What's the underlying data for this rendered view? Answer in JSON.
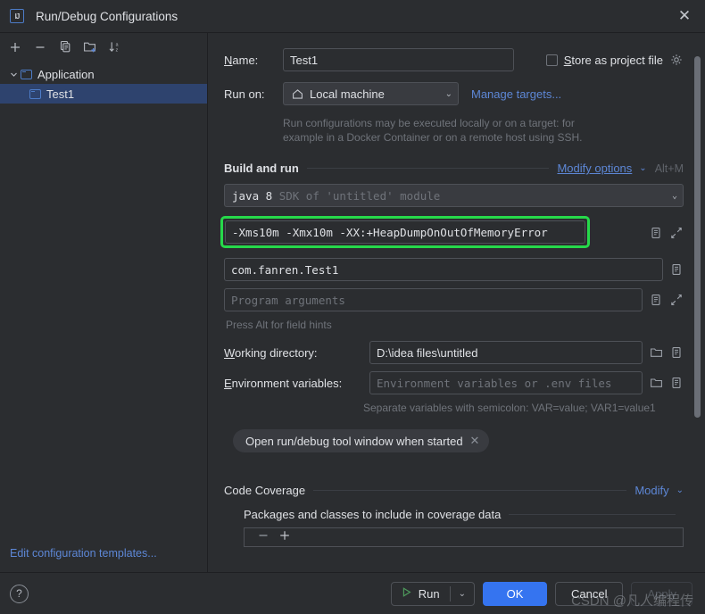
{
  "window": {
    "title": "Run/Debug Configurations",
    "logo_text": "IJ",
    "close_icon": "✕"
  },
  "sidebar": {
    "toolbar": [
      {
        "name": "add-configuration-button",
        "icon": "plus-icon",
        "glyph": "+"
      },
      {
        "name": "remove-configuration-button",
        "icon": "minus-icon",
        "glyph": "−"
      },
      {
        "name": "copy-configuration-button",
        "icon": "copy-icon",
        "glyph": ""
      },
      {
        "name": "new-folder-button",
        "icon": "new-folder-icon",
        "glyph": ""
      },
      {
        "name": "sort-configurations-button",
        "icon": "sort-az-icon",
        "glyph": ""
      }
    ],
    "tree": [
      {
        "label": "Application",
        "expanded": true,
        "selected": false,
        "chevron": "⌄"
      },
      {
        "label": "Test1",
        "expanded": false,
        "selected": true,
        "chevron": ""
      }
    ],
    "edit_templates_link": "Edit configuration templates..."
  },
  "form": {
    "name_label": "Name:",
    "name_label_mnemonic": "N",
    "name_value": "Test1",
    "store_as_project_file_label": "Store as project file",
    "store_as_project_file_mnemonic": "S",
    "store_as_project_file_checked": false,
    "store_gear_icon": "gear-icon",
    "run_on_label": "Run on:",
    "run_on_value": "Local machine",
    "run_on_icon": "home-icon",
    "manage_targets_link": "Manage targets...",
    "run_on_hint_line1": "Run configurations may be executed locally or on a target: for",
    "run_on_hint_line2": "example in a Docker Container or on a remote host using SSH."
  },
  "build_and_run": {
    "section_title": "Build and run",
    "modify_options_link": "Modify options",
    "modify_options_shortcut": "Alt+M",
    "sdk_value_bright": "java 8",
    "sdk_value_dim": "SDK of 'untitled' module",
    "vm_options_value": "-Xms10m -Xmx10m -XX:+HeapDumpOnOutOfMemoryError",
    "vm_options_highlighted": true,
    "highlight_color": "#26d94a",
    "main_class_value": "com.fanren.Test1",
    "program_arguments_placeholder": "Program arguments",
    "press_alt_hint": "Press Alt for field hints",
    "working_directory_label": "Working directory:",
    "working_directory_mnemonic": "W",
    "working_directory_value": "D:\\idea files\\untitled",
    "environment_variables_label": "Environment variables:",
    "environment_variables_mnemonic": "E",
    "environment_variables_placeholder": "Environment variables or .env files",
    "env_separator_hint": "Separate variables with semicolon: VAR=value; VAR1=value1",
    "chip_label": "Open run/debug tool window when started",
    "chip_close_icon": "close-icon"
  },
  "code_coverage": {
    "section_title": "Code Coverage",
    "modify_link": "Modify",
    "packages_label": "Packages and classes to include in coverage data",
    "remove_icon": "minus-icon",
    "add_icon": "plus-icon"
  },
  "footer": {
    "help_label": "?",
    "run_label": "Run",
    "run_icon": "play-icon",
    "ok_label": "OK",
    "cancel_label": "Cancel",
    "apply_label": "Apply",
    "apply_enabled": false,
    "accent_color": "#3574f0"
  },
  "watermark": {
    "text": "CSDN @凡人编程传"
  }
}
